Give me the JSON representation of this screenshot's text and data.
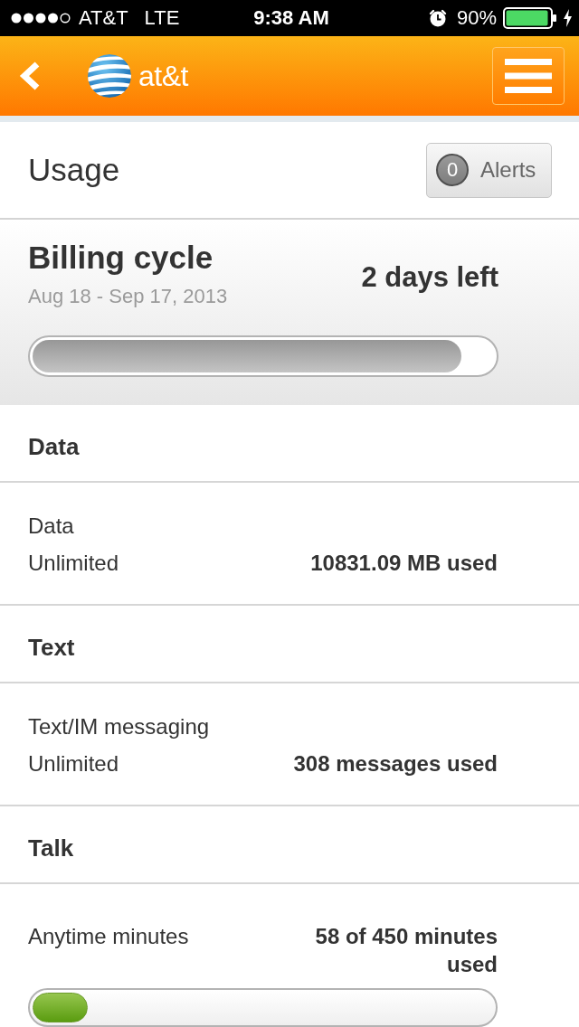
{
  "status_bar": {
    "carrier": "AT&T",
    "network": "LTE",
    "time": "9:38 AM",
    "battery": "90%"
  },
  "header": {
    "brand": "at&t"
  },
  "page": {
    "title": "Usage",
    "alerts": {
      "count": "0",
      "label": "Alerts"
    }
  },
  "billing_cycle": {
    "title": "Billing cycle",
    "dates": "Aug 18 - Sep 17, 2013",
    "remaining": "2 days left",
    "level": 0.93
  },
  "sections": [
    {
      "title": "Data",
      "items": [
        {
          "kind": "plan",
          "name": "Data",
          "plan": "Unlimited",
          "usage": "10831.09 MB used"
        }
      ]
    },
    {
      "title": "Text",
      "items": [
        {
          "kind": "plan",
          "name": "Text/IM messaging",
          "plan": "Unlimited",
          "usage": "308 messages used"
        }
      ]
    },
    {
      "title": "Talk",
      "items": [
        {
          "kind": "meter",
          "name": "Anytime minutes",
          "usage": "58 of 450 minutes used",
          "level": 0.12
        }
      ]
    }
  ]
}
